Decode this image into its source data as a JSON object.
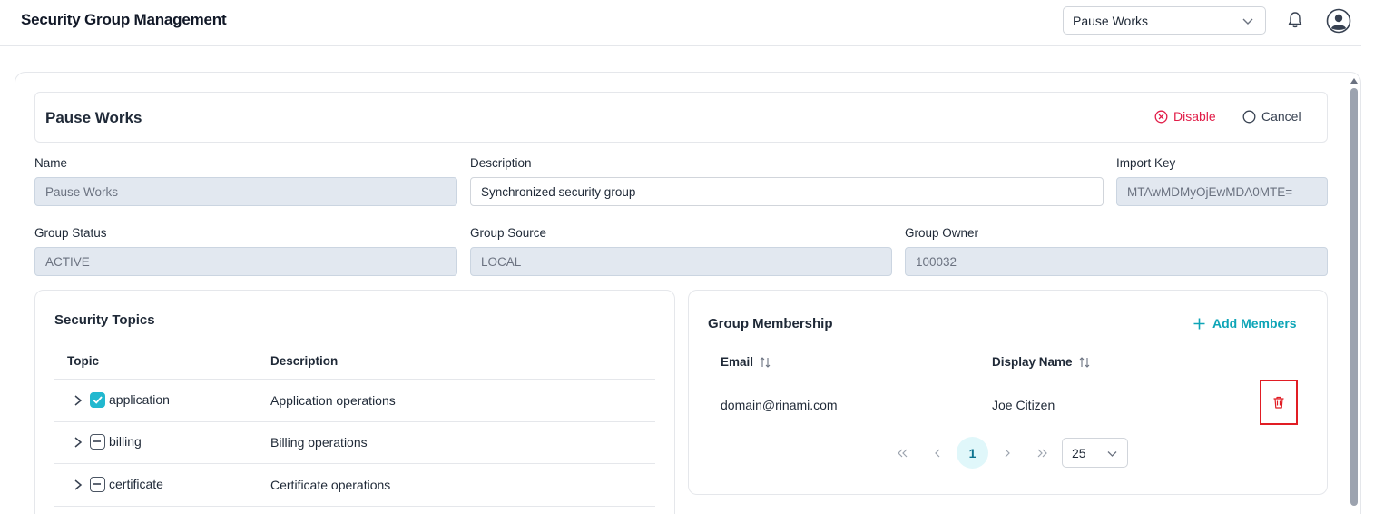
{
  "header": {
    "title": "Security Group Management",
    "group_select": "Pause Works"
  },
  "group": {
    "title": "Pause Works",
    "actions": {
      "disable": "Disable",
      "cancel": "Cancel"
    }
  },
  "fields": {
    "name": {
      "label": "Name",
      "value": "Pause Works"
    },
    "description": {
      "label": "Description",
      "value": "Synchronized security group"
    },
    "import_key": {
      "label": "Import Key",
      "value": "MTAwMDMyOjEwMDA0MTE="
    },
    "status": {
      "label": "Group Status",
      "value": "ACTIVE"
    },
    "source": {
      "label": "Group Source",
      "value": "LOCAL"
    },
    "owner": {
      "label": "Group Owner",
      "value": "100032"
    }
  },
  "topics": {
    "title": "Security Topics",
    "columns": [
      "Topic",
      "Description"
    ],
    "rows": [
      {
        "name": "application",
        "description": "Application operations",
        "state": "checked"
      },
      {
        "name": "billing",
        "description": "Billing operations",
        "state": "partial"
      },
      {
        "name": "certificate",
        "description": "Certificate operations",
        "state": "partial"
      }
    ]
  },
  "membership": {
    "title": "Group Membership",
    "add_label": "Add Members",
    "columns": [
      "Email",
      "Display Name"
    ],
    "rows": [
      {
        "email": "domain@rinami.com",
        "display_name": "Joe Citizen"
      }
    ],
    "pagination": {
      "current_page": "1",
      "page_size": "25"
    }
  },
  "colors": {
    "accent": "#22b8cf",
    "danger": "#e11d48",
    "readonly_field": "#e2e8f0"
  }
}
